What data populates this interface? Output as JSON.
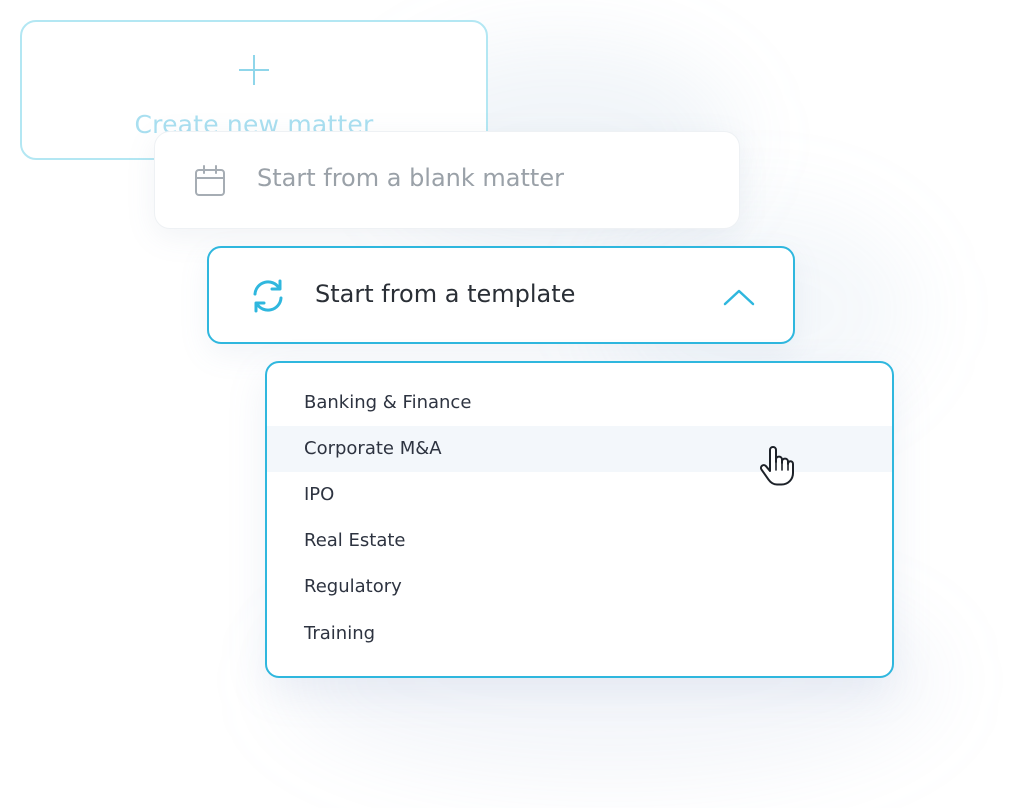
{
  "create_card": {
    "label": "Create new matter",
    "icon": "plus-icon",
    "color": "#a9dff0"
  },
  "blank_card": {
    "label": "Start from a blank matter",
    "icon": "calendar-icon"
  },
  "template_card": {
    "label": "Start from a template",
    "icon": "refresh-icon",
    "chevron": "chevron-up-icon",
    "accent": "#2fb7de"
  },
  "dropdown": {
    "items": [
      {
        "label": "Banking & Finance"
      },
      {
        "label": "Corporate M&A"
      },
      {
        "label": "IPO"
      },
      {
        "label": "Real Estate"
      },
      {
        "label": "Regulatory"
      },
      {
        "label": "Training"
      }
    ],
    "hovered_index": 1
  },
  "cursor": {
    "icon": "hand-pointer-icon"
  }
}
